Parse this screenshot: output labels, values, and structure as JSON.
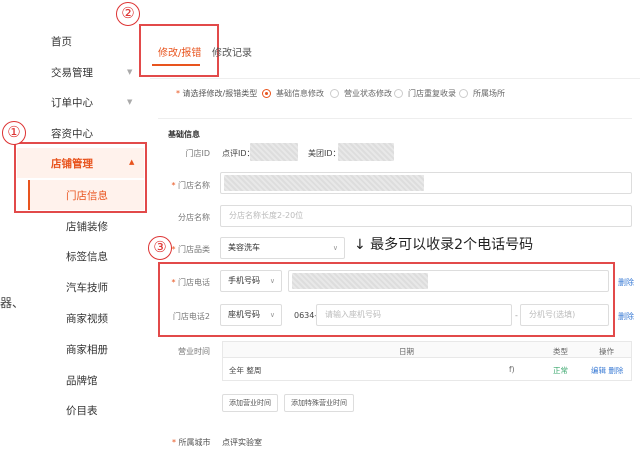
{
  "sidebar": {
    "items": [
      {
        "label": "首页",
        "has_caret": false
      },
      {
        "label": "交易管理",
        "has_caret": true
      },
      {
        "label": "订单中心",
        "has_caret": true
      },
      {
        "label": "容资中心",
        "has_caret": false
      }
    ],
    "active_group": {
      "label": "店铺管理",
      "caret": "▲"
    },
    "active_subitem": "门店信息",
    "subitems": [
      "店铺装修",
      "标签信息",
      "汽车技师",
      "商家视频",
      "商家相册",
      "品牌馆",
      "价目表"
    ],
    "stray_text": "器、"
  },
  "annotations": {
    "badge_1": "①",
    "badge_2": "②",
    "badge_3": "③",
    "note": "↓ 最多可以收录2个电话号码"
  },
  "tabs": [
    {
      "label": "修改/报错",
      "active": true
    },
    {
      "label": "修改记录",
      "active": false
    }
  ],
  "modify_type": {
    "label": "请选择修改/报错类型",
    "options": [
      {
        "label": "基础信息修改",
        "selected": true
      },
      {
        "label": "营业状态修改",
        "selected": false
      },
      {
        "label": "门店重复收录",
        "selected": false
      },
      {
        "label": "所属场所",
        "selected": false
      }
    ]
  },
  "basic_info": {
    "title": "基础信息",
    "store_id_label": "门店ID",
    "dianping_id_label": "点评ID：",
    "meituan_id_label": "美团ID：",
    "store_name_label": "门店名称",
    "branch_name_label": "分店名称",
    "branch_name_placeholder": "分店名称长度2-20位",
    "category_label": "门店品类",
    "category_value": "美容洗车",
    "phone_label": "门店电话",
    "phone_type_value": "手机号码",
    "phone2_label": "门店电话2",
    "phone2_type_value": "座机号码",
    "area_code": "0634-",
    "landline_placeholder": "请输入座机号码",
    "ext_prefix": "-",
    "ext_placeholder": "分机号(选填)",
    "delete_label": "删除"
  },
  "hours": {
    "label": "营业时间",
    "columns": [
      "日期",
      "类型",
      "操作"
    ],
    "rows": [
      {
        "date": "全年 整周",
        "time_fragment": "f)",
        "type": "正常",
        "ops": "编辑 删除"
      }
    ],
    "add_hours_button": "添加营业时间",
    "add_special_button": "添加特殊营业时间"
  },
  "city": {
    "label": "所属城市",
    "value": "点评实验室"
  },
  "colors": {
    "accent": "#e8541e",
    "annotation_red": "#e24a4a",
    "link_blue": "#3a7bd5",
    "normal_green": "#3aa76d"
  }
}
